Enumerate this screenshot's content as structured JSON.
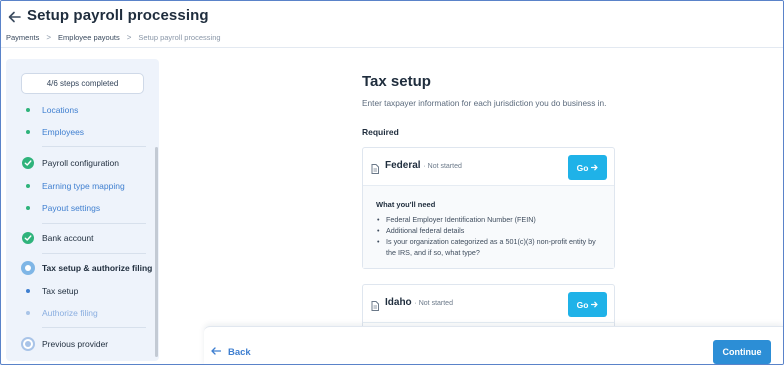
{
  "header": {
    "title": "Setup payroll processing",
    "breadcrumb": [
      "Payments",
      "Employee payouts",
      "Setup payroll processing"
    ]
  },
  "sidebar": {
    "progress_label": "4/6 steps completed",
    "items": [
      {
        "label": "Locations",
        "kind": "substep-done"
      },
      {
        "label": "Employees",
        "kind": "substep-done"
      },
      {
        "label": "Payroll configuration",
        "kind": "step-complete"
      },
      {
        "label": "Earning type mapping",
        "kind": "substep-done"
      },
      {
        "label": "Payout settings",
        "kind": "substep-done"
      },
      {
        "label": "Bank account",
        "kind": "step-complete"
      },
      {
        "label": "Tax setup & authorize filing",
        "kind": "step-current"
      },
      {
        "label": "Tax setup",
        "kind": "substep-current"
      },
      {
        "label": "Authorize filing",
        "kind": "substep-pending"
      },
      {
        "label": "Previous provider",
        "kind": "step-pending"
      }
    ]
  },
  "main": {
    "title": "Tax setup",
    "subtitle": "Enter taxpayer information for each jurisdiction you do business in.",
    "required_label": "Required",
    "cards": [
      {
        "name": "Federal",
        "status": "· Not started",
        "button": "Go",
        "needs_title": "What you'll need",
        "needs": [
          "Federal Employer Identification Number (FEIN)",
          "Additional federal details",
          "Is your organization categorized as a 501(c)(3) non-profit entity by the IRS, and if so, what type?"
        ]
      },
      {
        "name": "Idaho",
        "status": "· Not started",
        "button": "Go"
      }
    ]
  },
  "footer": {
    "back_label": "Back",
    "continue_label": "Continue"
  },
  "colors": {
    "accent": "#1fb2e8",
    "primary": "#2c8ed6",
    "link": "#3f7fd0",
    "complete": "#2fb37b",
    "sidebar_bg": "#eef3fb"
  },
  "icons": [
    "back-arrow-icon",
    "chevron-right-icon",
    "check-icon",
    "document-icon",
    "arrow-right-icon",
    "arrow-left-icon"
  ]
}
